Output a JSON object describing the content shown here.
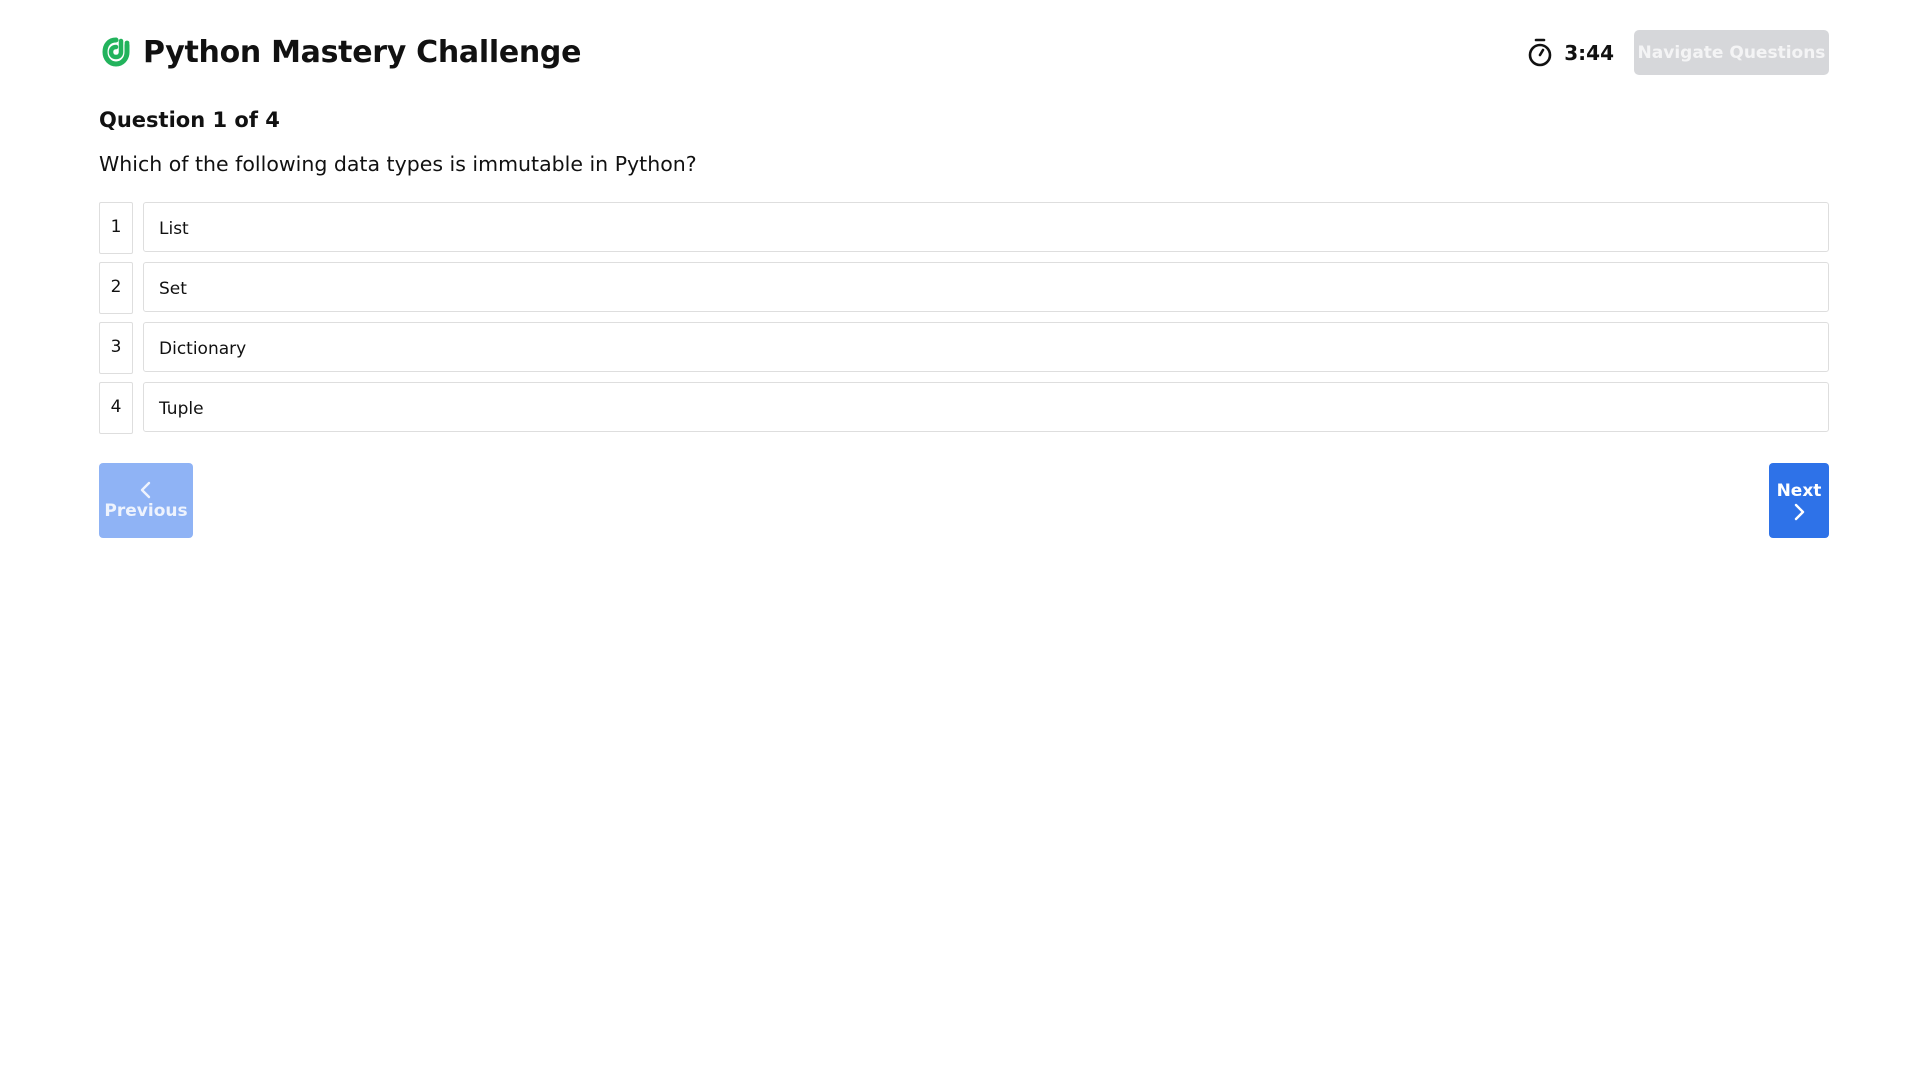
{
  "header": {
    "title": "Python Mastery Challenge",
    "logo_icon": "python-logo-icon",
    "timer_icon": "stopwatch-icon",
    "timer_value": "3:44",
    "navigate_label": "Navigate Questions"
  },
  "question": {
    "counter": "Question 1 of 4",
    "text": "Which of the following data types is immutable in Python?",
    "options": [
      {
        "number": "1",
        "label": "List"
      },
      {
        "number": "2",
        "label": "Set"
      },
      {
        "number": "3",
        "label": "Dictionary"
      },
      {
        "number": "4",
        "label": "Tuple"
      }
    ]
  },
  "footer": {
    "previous_label": "Previous",
    "next_label": "Next",
    "previous_icon": "chevron-left-icon",
    "next_icon": "chevron-right-icon"
  },
  "colors": {
    "brand_green": "#22b35c",
    "primary_blue": "#2e72e8",
    "disabled_blue": "#8fb3f5",
    "disabled_gray": "#d6d7da"
  }
}
